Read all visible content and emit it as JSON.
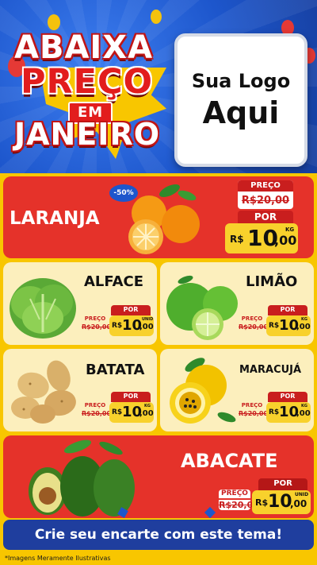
{
  "header": {
    "title_line1": "ABAIXA",
    "title_line2": "PREÇO",
    "title_line3": "EM",
    "title_line4": "JANEIRO",
    "logo_line1": "Sua Logo",
    "logo_line2": "Aqui"
  },
  "colors": {
    "header_blue": "#1f57c9",
    "card_red": "#e5322a",
    "card_cream": "#fcefbd",
    "price_yellow": "#f8d12c",
    "background_yellow": "#f8c600"
  },
  "products": [
    {
      "name": "LARANJA",
      "preco_label": "PREÇO",
      "old_price": "R$20,00",
      "por_label": "POR",
      "currency": "R$",
      "price_int": "10",
      "price_cents": ",00",
      "unit": "KG",
      "discount": "-50%"
    },
    {
      "name": "ALFACE",
      "preco_label": "PREÇO",
      "old_price": "R$20,00",
      "por_label": "POR",
      "currency": "R$",
      "price_int": "10",
      "price_cents": ",00",
      "unit": "UNID"
    },
    {
      "name": "LIMÃO",
      "preco_label": "PREÇO",
      "old_price": "R$20,00",
      "por_label": "POR",
      "currency": "R$",
      "price_int": "10",
      "price_cents": ",00",
      "unit": "KG"
    },
    {
      "name": "BATATA",
      "preco_label": "PREÇO",
      "old_price": "R$20,00",
      "por_label": "POR",
      "currency": "R$",
      "price_int": "10",
      "price_cents": ",00",
      "unit": "KG"
    },
    {
      "name": "MARACUJÁ",
      "preco_label": "PREÇO",
      "old_price": "R$20,00",
      "por_label": "POR",
      "currency": "R$",
      "price_int": "10",
      "price_cents": ",00",
      "unit": "KG"
    },
    {
      "name": "ABACATE",
      "preco_label": "PREÇO",
      "old_price": "R$20,00",
      "por_label": "POR",
      "currency": "R$",
      "price_int": "10",
      "price_cents": ",00",
      "unit": "UNID"
    }
  ],
  "footer": {
    "cta": "Crie seu encarte com este tema!",
    "disclaimer": "*Imagens Meramente Ilustrativas"
  }
}
